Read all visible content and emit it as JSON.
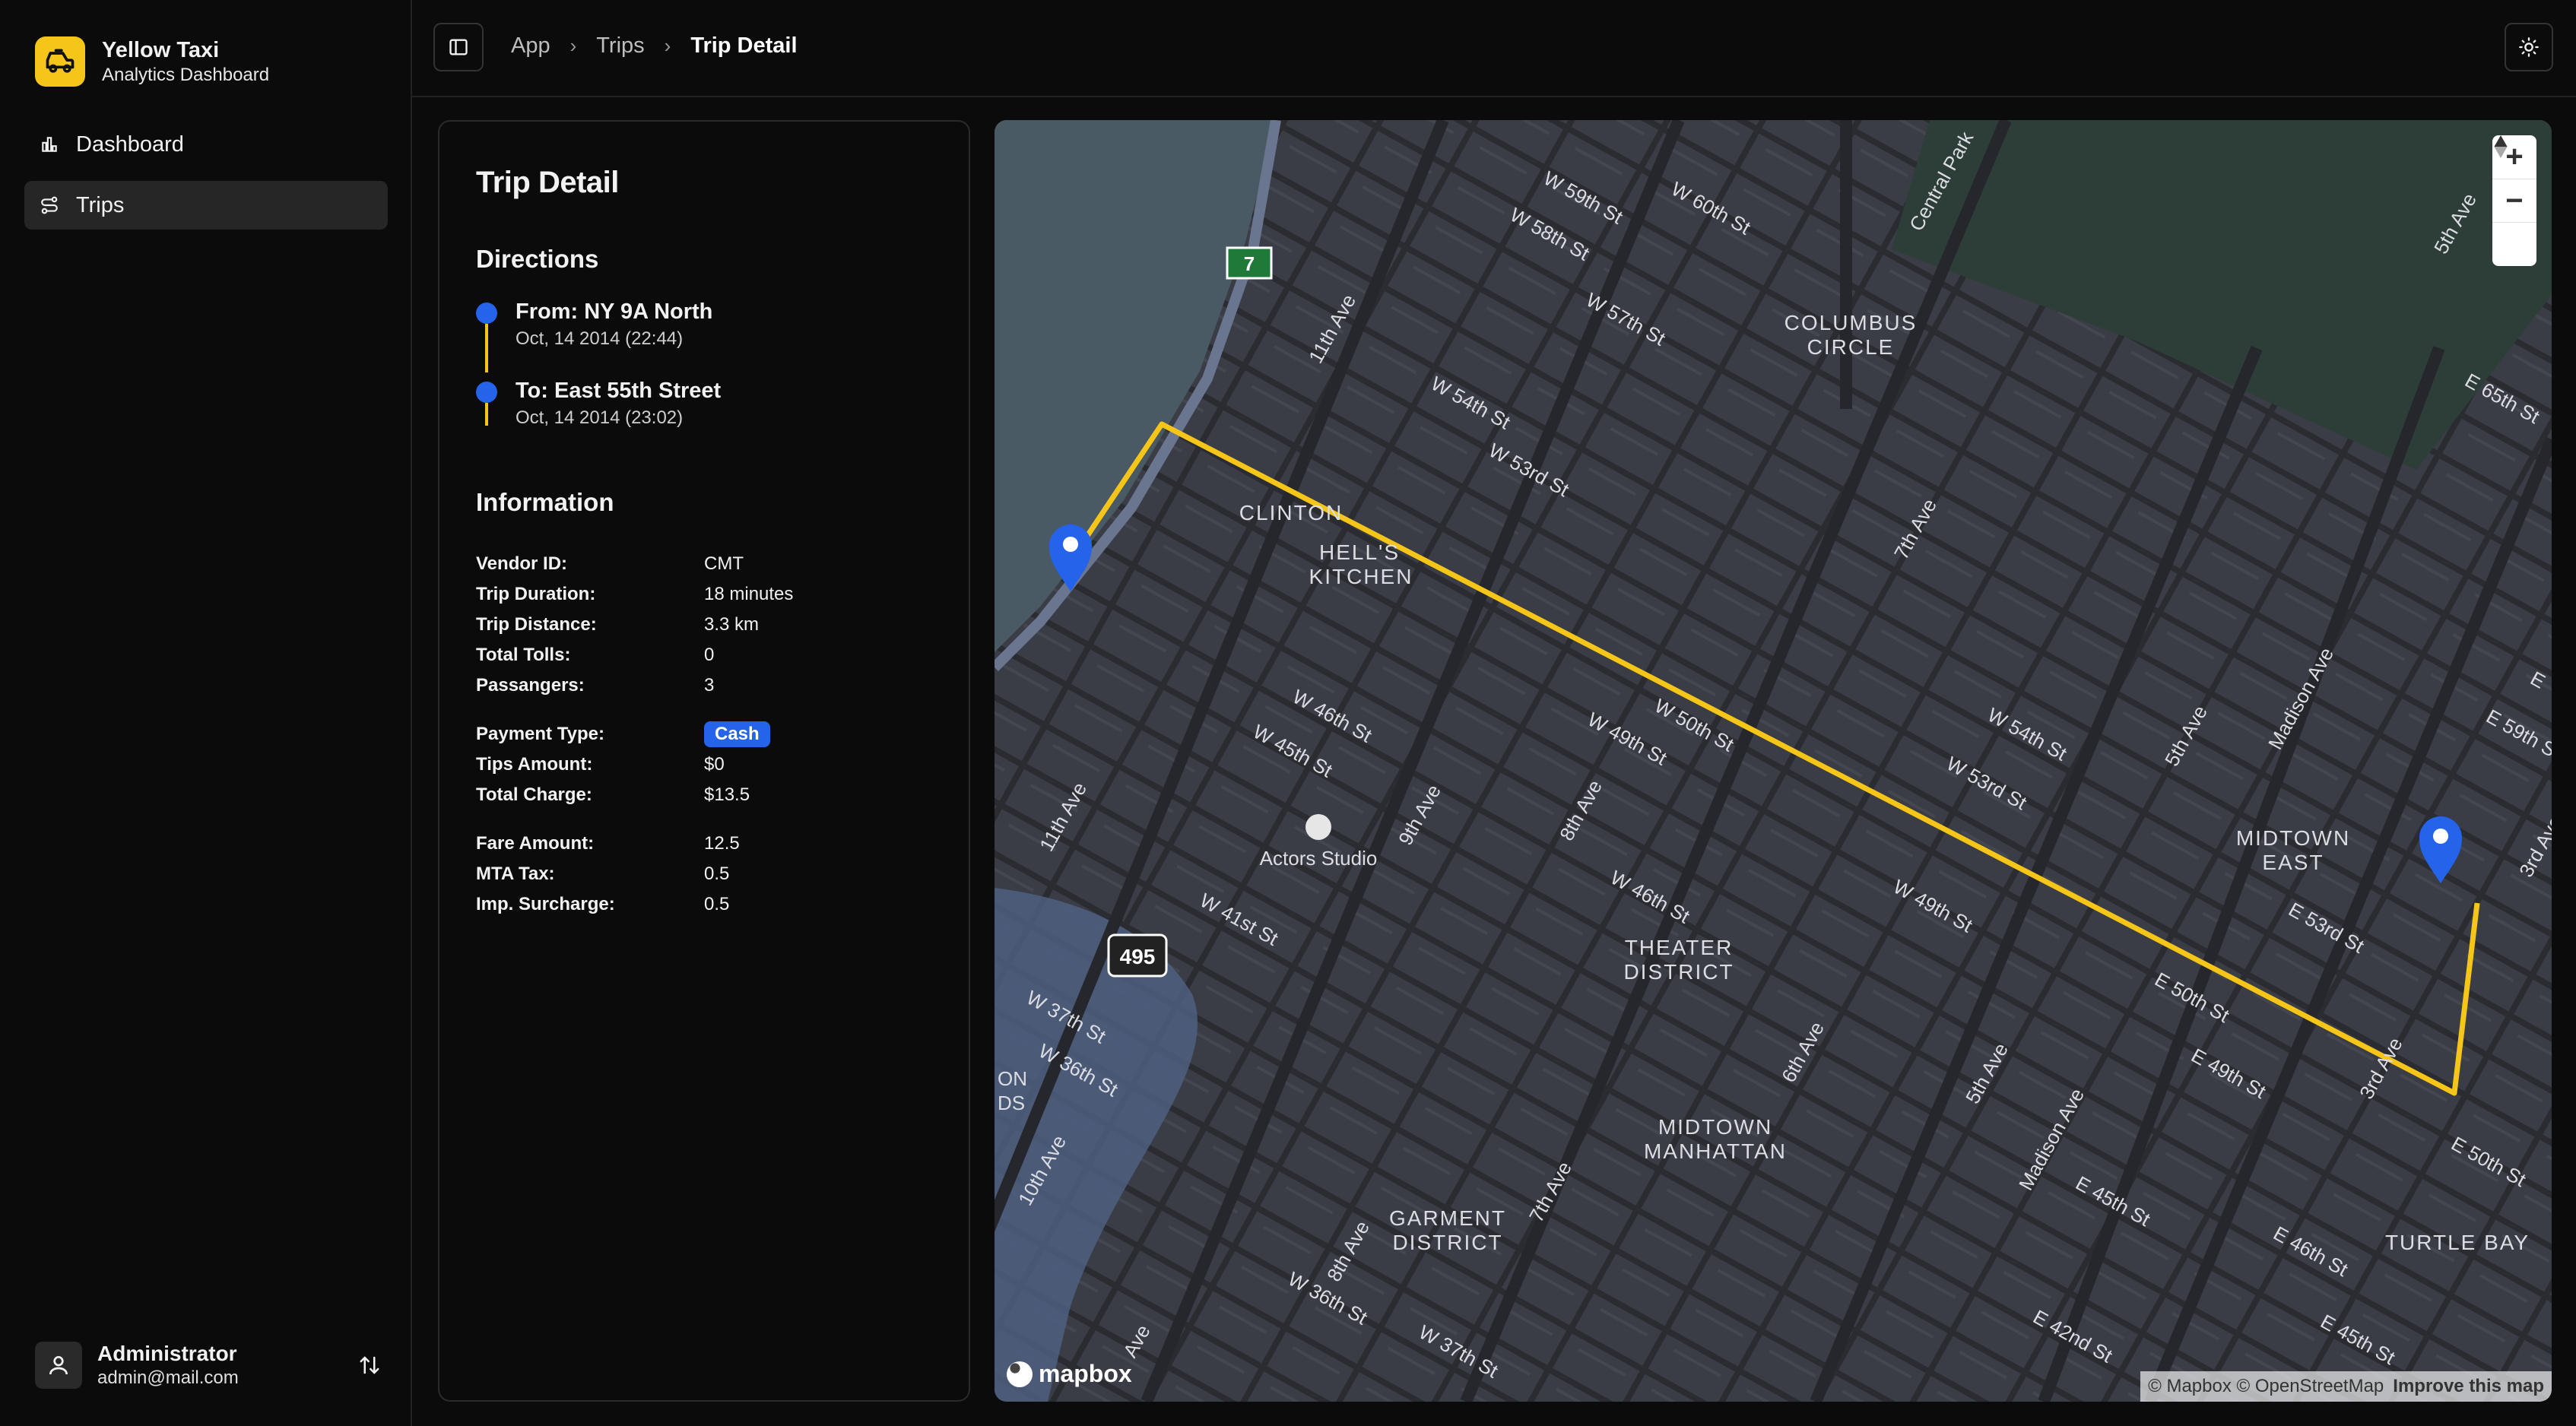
{
  "brand": {
    "title": "Yellow Taxi",
    "subtitle": "Analytics Dashboard",
    "logo_icon": "taxi-icon",
    "accent": "#f5c518"
  },
  "sidebar": {
    "items": [
      {
        "label": "Dashboard",
        "icon": "bar-chart-icon",
        "active": false
      },
      {
        "label": "Trips",
        "icon": "route-icon",
        "active": true
      }
    ]
  },
  "user": {
    "name": "Administrator",
    "email": "admin@mail.com"
  },
  "breadcrumb": {
    "items": [
      "App",
      "Trips"
    ],
    "current": "Trip Detail"
  },
  "detail": {
    "title": "Trip Detail",
    "directions_title": "Directions",
    "from": {
      "label": "From: NY 9A North",
      "datetime": "Oct, 14 2014 (22:44)"
    },
    "to": {
      "label": "To: East 55th Street",
      "datetime": "Oct, 14 2014 (23:02)"
    },
    "information_title": "Information",
    "info": {
      "vendor_label": "Vendor ID:",
      "vendor": "CMT",
      "duration_label": "Trip Duration:",
      "duration": "18 minutes",
      "distance_label": "Trip Distance:",
      "distance": "3.3 km",
      "tolls_label": "Total Tolls:",
      "tolls": "0",
      "passengers_label": "Passangers:",
      "passengers": "3",
      "payment_label": "Payment Type:",
      "payment": "Cash",
      "tips_label": "Tips Amount:",
      "tips": "$0",
      "charge_label": "Total Charge:",
      "charge": "$13.5",
      "fare_label": "Fare Amount:",
      "fare": "12.5",
      "mta_label": "MTA Tax:",
      "mta": "0.5",
      "surcharge_label": "Imp. Surcharge:",
      "surcharge": "0.5"
    }
  },
  "map": {
    "labels": {
      "clinton": "CLINTON",
      "hells_kitchen_1": "HELL'S",
      "hells_kitchen_2": "KITCHEN",
      "columbus_1": "COLUMBUS",
      "columbus_2": "CIRCLE",
      "theater_1": "THEATER",
      "theater_2": "DISTRICT",
      "midtown_manhattan_1": "MIDTOWN",
      "midtown_manhattan_2": "MANHATTAN",
      "garment_1": "GARMENT",
      "garment_2": "DISTRICT",
      "midtown_east_1": "MIDTOWN",
      "midtown_east_2": "EAST",
      "turtle_bay": "TURTLE BAY",
      "actors_studio": "Actors Studio",
      "route_7": "7",
      "route_495": "495",
      "w59": "W 59th St",
      "w60": "W 60th St",
      "w58": "W 58th St",
      "w57": "W 57th St",
      "w54": "W 54th St",
      "w53": "W 53rd St",
      "w50": "W 50th St",
      "w49": "W 49th St",
      "w46": "W 46th St",
      "w45": "W 45th St",
      "w41": "W 41st St",
      "w37": "W 37th St",
      "w36": "W 36th St",
      "w49b": "W 49th St",
      "w46b": "W 46th St",
      "w53b": "W 53rd St",
      "w54b": "W 54th St",
      "w36b": "W 36th St",
      "w37b": "W 37th St",
      "e65": "E 65th St",
      "e59": "E 59th St",
      "e53": "E 53rd St",
      "e50": "E 50th St",
      "e49": "E 49th St",
      "e50b": "E 50th St",
      "e46": "E 46th St",
      "e45": "E 45th St",
      "e45b": "E 45th St",
      "e42": "E 42nd St",
      "ave11": "11th Ave",
      "ave11b": "11th Ave",
      "ave10": "10th Ave",
      "ave9": "9th Ave",
      "ave8": "8th Ave",
      "ave8b": "8th Ave",
      "ave7": "7th Ave",
      "ave7b": "7th Ave",
      "ave6": "6th Ave",
      "ave5": "5th Ave",
      "ave5b": "5th Ave",
      "ave5c": "5th Ave",
      "madison": "Madison Ave",
      "madison2": "Madison Ave",
      "ave3": "3rd Ave",
      "ave3b": "3rd Ave",
      "central_park": "Central Park",
      "e_cut": "E",
      "edge_on": "ON",
      "edge_ds": "DS",
      "edge_ave": "Ave"
    },
    "zoom_in": "+",
    "zoom_out": "−",
    "attribution": "© Mapbox © OpenStreetMap",
    "improve": "Improve this map",
    "mapbox": "mapbox",
    "route_color": "#f5c518",
    "pin_color": "#2563eb"
  }
}
